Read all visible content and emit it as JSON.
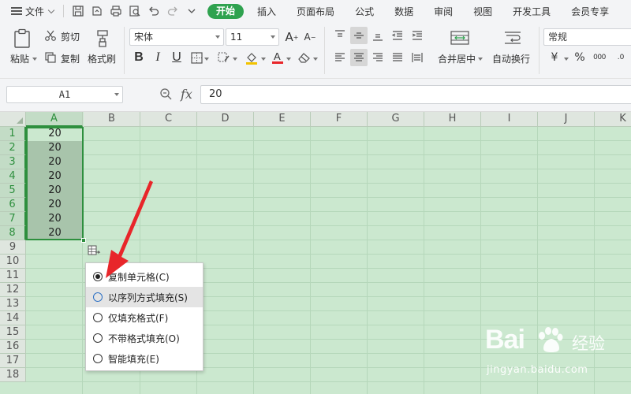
{
  "menubar": {
    "file_label": "文件",
    "tabs": [
      {
        "label": "开始",
        "active": true
      },
      {
        "label": "插入"
      },
      {
        "label": "页面布局"
      },
      {
        "label": "公式"
      },
      {
        "label": "数据"
      },
      {
        "label": "审阅"
      },
      {
        "label": "视图"
      },
      {
        "label": "开发工具"
      },
      {
        "label": "会员专享"
      }
    ]
  },
  "ribbon": {
    "paste": "粘贴",
    "cut": "剪切",
    "copy": "复制",
    "format_painter": "格式刷",
    "font_name": "宋体",
    "font_size": "11",
    "merge_center": "合并居中",
    "wrap_text": "自动换行",
    "number_format": "常规",
    "currency_symbol": "¥",
    "percent_symbol": "%",
    "thousands_label": "000"
  },
  "formula_bar": {
    "name_box": "A1",
    "fx": "fx",
    "value": "20"
  },
  "grid": {
    "columns": [
      "A",
      "B",
      "C",
      "D",
      "E",
      "F",
      "G",
      "H",
      "I",
      "J",
      "K"
    ],
    "rows": [
      "1",
      "2",
      "3",
      "4",
      "5",
      "6",
      "7",
      "8",
      "9",
      "10",
      "11",
      "12",
      "13",
      "14",
      "15",
      "16",
      "17",
      "18"
    ],
    "cells_A": [
      "20",
      "20",
      "20",
      "20",
      "20",
      "20",
      "20",
      "20"
    ]
  },
  "autofill_menu": {
    "items": [
      {
        "label": "复制单元格(C)",
        "selected": true
      },
      {
        "label": "以序列方式填充(S)",
        "hover": true
      },
      {
        "label": "仅填充格式(F)"
      },
      {
        "label": "不带格式填充(O)"
      },
      {
        "label": "智能填充(E)"
      }
    ]
  },
  "watermark": {
    "logo": "Bai",
    "logo_tail": "du",
    "cn": "经验",
    "url": "jingyan.baidu.com"
  },
  "colors": {
    "accent_green": "#2fa24f",
    "grid_background": "#cbe8cf",
    "selection_border": "#2e8f3e",
    "arrow_red": "#e8262a"
  }
}
